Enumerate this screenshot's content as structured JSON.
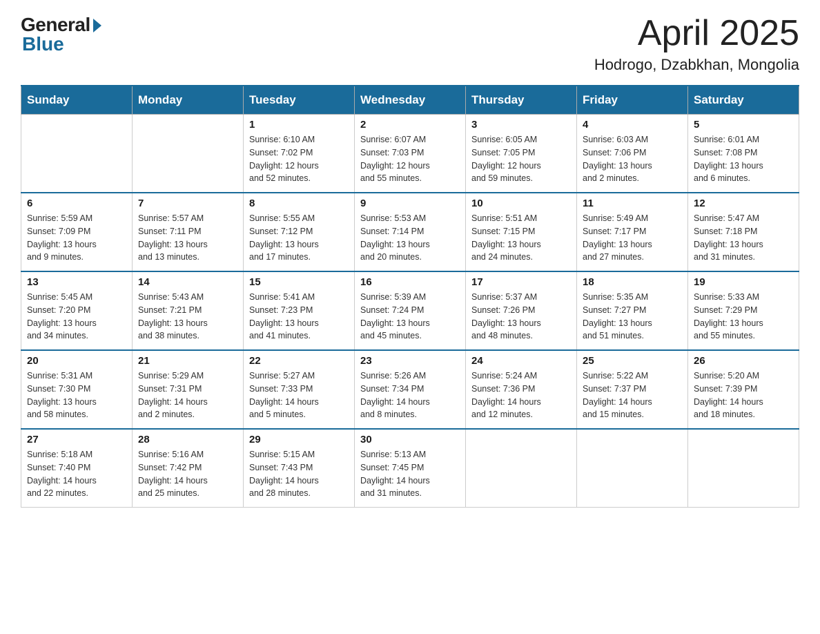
{
  "logo": {
    "general": "General",
    "blue": "Blue"
  },
  "title": {
    "month_year": "April 2025",
    "location": "Hodrogo, Dzabkhan, Mongolia"
  },
  "header_days": [
    "Sunday",
    "Monday",
    "Tuesday",
    "Wednesday",
    "Thursday",
    "Friday",
    "Saturday"
  ],
  "weeks": [
    [
      {
        "day": "",
        "info": ""
      },
      {
        "day": "",
        "info": ""
      },
      {
        "day": "1",
        "info": "Sunrise: 6:10 AM\nSunset: 7:02 PM\nDaylight: 12 hours\nand 52 minutes."
      },
      {
        "day": "2",
        "info": "Sunrise: 6:07 AM\nSunset: 7:03 PM\nDaylight: 12 hours\nand 55 minutes."
      },
      {
        "day": "3",
        "info": "Sunrise: 6:05 AM\nSunset: 7:05 PM\nDaylight: 12 hours\nand 59 minutes."
      },
      {
        "day": "4",
        "info": "Sunrise: 6:03 AM\nSunset: 7:06 PM\nDaylight: 13 hours\nand 2 minutes."
      },
      {
        "day": "5",
        "info": "Sunrise: 6:01 AM\nSunset: 7:08 PM\nDaylight: 13 hours\nand 6 minutes."
      }
    ],
    [
      {
        "day": "6",
        "info": "Sunrise: 5:59 AM\nSunset: 7:09 PM\nDaylight: 13 hours\nand 9 minutes."
      },
      {
        "day": "7",
        "info": "Sunrise: 5:57 AM\nSunset: 7:11 PM\nDaylight: 13 hours\nand 13 minutes."
      },
      {
        "day": "8",
        "info": "Sunrise: 5:55 AM\nSunset: 7:12 PM\nDaylight: 13 hours\nand 17 minutes."
      },
      {
        "day": "9",
        "info": "Sunrise: 5:53 AM\nSunset: 7:14 PM\nDaylight: 13 hours\nand 20 minutes."
      },
      {
        "day": "10",
        "info": "Sunrise: 5:51 AM\nSunset: 7:15 PM\nDaylight: 13 hours\nand 24 minutes."
      },
      {
        "day": "11",
        "info": "Sunrise: 5:49 AM\nSunset: 7:17 PM\nDaylight: 13 hours\nand 27 minutes."
      },
      {
        "day": "12",
        "info": "Sunrise: 5:47 AM\nSunset: 7:18 PM\nDaylight: 13 hours\nand 31 minutes."
      }
    ],
    [
      {
        "day": "13",
        "info": "Sunrise: 5:45 AM\nSunset: 7:20 PM\nDaylight: 13 hours\nand 34 minutes."
      },
      {
        "day": "14",
        "info": "Sunrise: 5:43 AM\nSunset: 7:21 PM\nDaylight: 13 hours\nand 38 minutes."
      },
      {
        "day": "15",
        "info": "Sunrise: 5:41 AM\nSunset: 7:23 PM\nDaylight: 13 hours\nand 41 minutes."
      },
      {
        "day": "16",
        "info": "Sunrise: 5:39 AM\nSunset: 7:24 PM\nDaylight: 13 hours\nand 45 minutes."
      },
      {
        "day": "17",
        "info": "Sunrise: 5:37 AM\nSunset: 7:26 PM\nDaylight: 13 hours\nand 48 minutes."
      },
      {
        "day": "18",
        "info": "Sunrise: 5:35 AM\nSunset: 7:27 PM\nDaylight: 13 hours\nand 51 minutes."
      },
      {
        "day": "19",
        "info": "Sunrise: 5:33 AM\nSunset: 7:29 PM\nDaylight: 13 hours\nand 55 minutes."
      }
    ],
    [
      {
        "day": "20",
        "info": "Sunrise: 5:31 AM\nSunset: 7:30 PM\nDaylight: 13 hours\nand 58 minutes."
      },
      {
        "day": "21",
        "info": "Sunrise: 5:29 AM\nSunset: 7:31 PM\nDaylight: 14 hours\nand 2 minutes."
      },
      {
        "day": "22",
        "info": "Sunrise: 5:27 AM\nSunset: 7:33 PM\nDaylight: 14 hours\nand 5 minutes."
      },
      {
        "day": "23",
        "info": "Sunrise: 5:26 AM\nSunset: 7:34 PM\nDaylight: 14 hours\nand 8 minutes."
      },
      {
        "day": "24",
        "info": "Sunrise: 5:24 AM\nSunset: 7:36 PM\nDaylight: 14 hours\nand 12 minutes."
      },
      {
        "day": "25",
        "info": "Sunrise: 5:22 AM\nSunset: 7:37 PM\nDaylight: 14 hours\nand 15 minutes."
      },
      {
        "day": "26",
        "info": "Sunrise: 5:20 AM\nSunset: 7:39 PM\nDaylight: 14 hours\nand 18 minutes."
      }
    ],
    [
      {
        "day": "27",
        "info": "Sunrise: 5:18 AM\nSunset: 7:40 PM\nDaylight: 14 hours\nand 22 minutes."
      },
      {
        "day": "28",
        "info": "Sunrise: 5:16 AM\nSunset: 7:42 PM\nDaylight: 14 hours\nand 25 minutes."
      },
      {
        "day": "29",
        "info": "Sunrise: 5:15 AM\nSunset: 7:43 PM\nDaylight: 14 hours\nand 28 minutes."
      },
      {
        "day": "30",
        "info": "Sunrise: 5:13 AM\nSunset: 7:45 PM\nDaylight: 14 hours\nand 31 minutes."
      },
      {
        "day": "",
        "info": ""
      },
      {
        "day": "",
        "info": ""
      },
      {
        "day": "",
        "info": ""
      }
    ]
  ]
}
